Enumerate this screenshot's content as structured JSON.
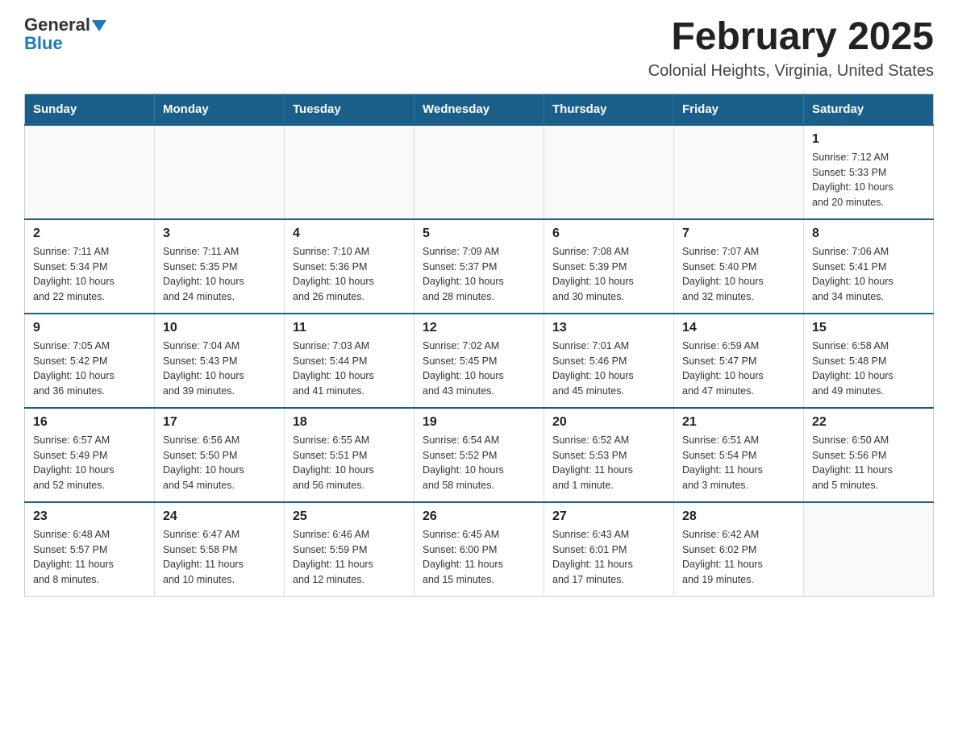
{
  "logo": {
    "general": "General",
    "blue": "Blue"
  },
  "title": "February 2025",
  "location": "Colonial Heights, Virginia, United States",
  "weekdays": [
    "Sunday",
    "Monday",
    "Tuesday",
    "Wednesday",
    "Thursday",
    "Friday",
    "Saturday"
  ],
  "weeks": [
    [
      {
        "day": "",
        "info": ""
      },
      {
        "day": "",
        "info": ""
      },
      {
        "day": "",
        "info": ""
      },
      {
        "day": "",
        "info": ""
      },
      {
        "day": "",
        "info": ""
      },
      {
        "day": "",
        "info": ""
      },
      {
        "day": "1",
        "info": "Sunrise: 7:12 AM\nSunset: 5:33 PM\nDaylight: 10 hours\nand 20 minutes."
      }
    ],
    [
      {
        "day": "2",
        "info": "Sunrise: 7:11 AM\nSunset: 5:34 PM\nDaylight: 10 hours\nand 22 minutes."
      },
      {
        "day": "3",
        "info": "Sunrise: 7:11 AM\nSunset: 5:35 PM\nDaylight: 10 hours\nand 24 minutes."
      },
      {
        "day": "4",
        "info": "Sunrise: 7:10 AM\nSunset: 5:36 PM\nDaylight: 10 hours\nand 26 minutes."
      },
      {
        "day": "5",
        "info": "Sunrise: 7:09 AM\nSunset: 5:37 PM\nDaylight: 10 hours\nand 28 minutes."
      },
      {
        "day": "6",
        "info": "Sunrise: 7:08 AM\nSunset: 5:39 PM\nDaylight: 10 hours\nand 30 minutes."
      },
      {
        "day": "7",
        "info": "Sunrise: 7:07 AM\nSunset: 5:40 PM\nDaylight: 10 hours\nand 32 minutes."
      },
      {
        "day": "8",
        "info": "Sunrise: 7:06 AM\nSunset: 5:41 PM\nDaylight: 10 hours\nand 34 minutes."
      }
    ],
    [
      {
        "day": "9",
        "info": "Sunrise: 7:05 AM\nSunset: 5:42 PM\nDaylight: 10 hours\nand 36 minutes."
      },
      {
        "day": "10",
        "info": "Sunrise: 7:04 AM\nSunset: 5:43 PM\nDaylight: 10 hours\nand 39 minutes."
      },
      {
        "day": "11",
        "info": "Sunrise: 7:03 AM\nSunset: 5:44 PM\nDaylight: 10 hours\nand 41 minutes."
      },
      {
        "day": "12",
        "info": "Sunrise: 7:02 AM\nSunset: 5:45 PM\nDaylight: 10 hours\nand 43 minutes."
      },
      {
        "day": "13",
        "info": "Sunrise: 7:01 AM\nSunset: 5:46 PM\nDaylight: 10 hours\nand 45 minutes."
      },
      {
        "day": "14",
        "info": "Sunrise: 6:59 AM\nSunset: 5:47 PM\nDaylight: 10 hours\nand 47 minutes."
      },
      {
        "day": "15",
        "info": "Sunrise: 6:58 AM\nSunset: 5:48 PM\nDaylight: 10 hours\nand 49 minutes."
      }
    ],
    [
      {
        "day": "16",
        "info": "Sunrise: 6:57 AM\nSunset: 5:49 PM\nDaylight: 10 hours\nand 52 minutes."
      },
      {
        "day": "17",
        "info": "Sunrise: 6:56 AM\nSunset: 5:50 PM\nDaylight: 10 hours\nand 54 minutes."
      },
      {
        "day": "18",
        "info": "Sunrise: 6:55 AM\nSunset: 5:51 PM\nDaylight: 10 hours\nand 56 minutes."
      },
      {
        "day": "19",
        "info": "Sunrise: 6:54 AM\nSunset: 5:52 PM\nDaylight: 10 hours\nand 58 minutes."
      },
      {
        "day": "20",
        "info": "Sunrise: 6:52 AM\nSunset: 5:53 PM\nDaylight: 11 hours\nand 1 minute."
      },
      {
        "day": "21",
        "info": "Sunrise: 6:51 AM\nSunset: 5:54 PM\nDaylight: 11 hours\nand 3 minutes."
      },
      {
        "day": "22",
        "info": "Sunrise: 6:50 AM\nSunset: 5:56 PM\nDaylight: 11 hours\nand 5 minutes."
      }
    ],
    [
      {
        "day": "23",
        "info": "Sunrise: 6:48 AM\nSunset: 5:57 PM\nDaylight: 11 hours\nand 8 minutes."
      },
      {
        "day": "24",
        "info": "Sunrise: 6:47 AM\nSunset: 5:58 PM\nDaylight: 11 hours\nand 10 minutes."
      },
      {
        "day": "25",
        "info": "Sunrise: 6:46 AM\nSunset: 5:59 PM\nDaylight: 11 hours\nand 12 minutes."
      },
      {
        "day": "26",
        "info": "Sunrise: 6:45 AM\nSunset: 6:00 PM\nDaylight: 11 hours\nand 15 minutes."
      },
      {
        "day": "27",
        "info": "Sunrise: 6:43 AM\nSunset: 6:01 PM\nDaylight: 11 hours\nand 17 minutes."
      },
      {
        "day": "28",
        "info": "Sunrise: 6:42 AM\nSunset: 6:02 PM\nDaylight: 11 hours\nand 19 minutes."
      },
      {
        "day": "",
        "info": ""
      }
    ]
  ]
}
